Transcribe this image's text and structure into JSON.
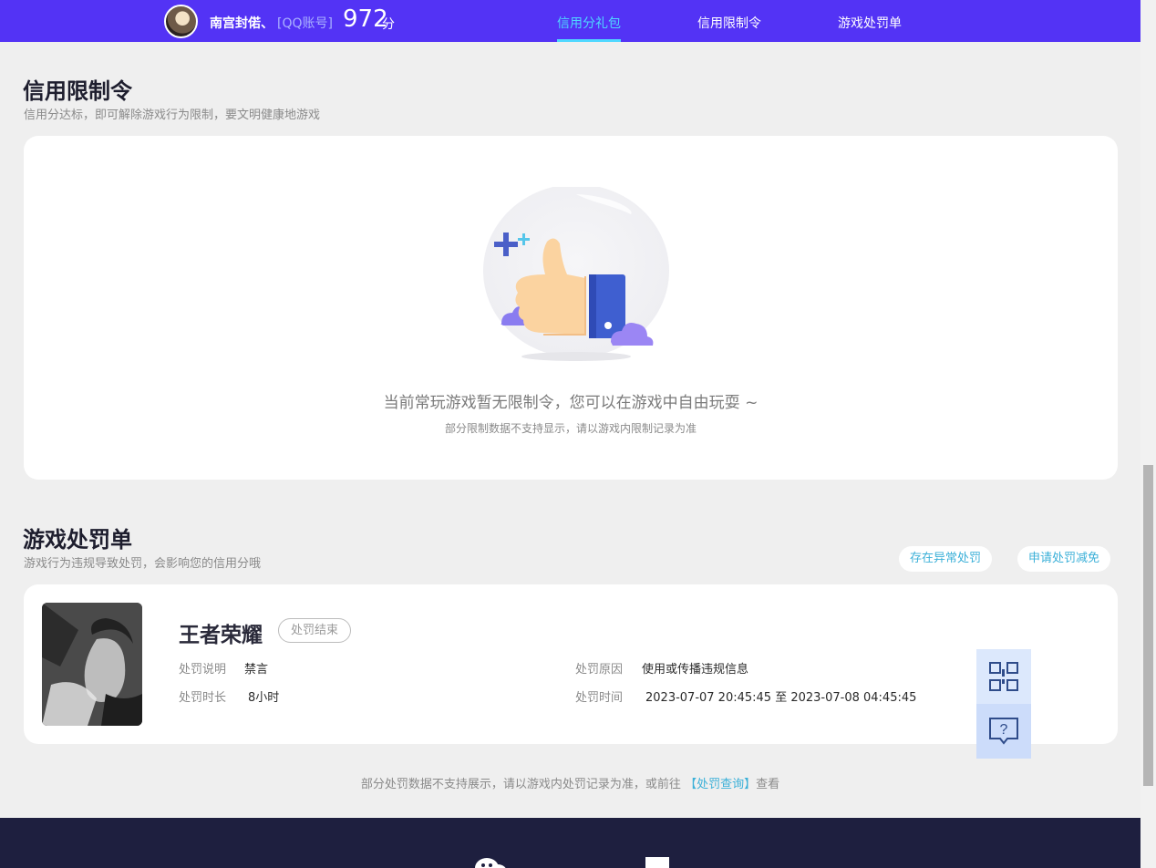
{
  "header": {
    "nickname": "南宫封偌、",
    "account_type": "[QQ账号]",
    "score": "972",
    "score_unit": "分",
    "nav": [
      {
        "label": "信用分礼包",
        "active": true
      },
      {
        "label": "信用限制令",
        "active": false
      },
      {
        "label": "游戏处罚单",
        "active": false
      }
    ],
    "accent_color": "#5333f5",
    "active_color": "#4fd8ff"
  },
  "restriction_section": {
    "title": "信用限制令",
    "subtitle": "信用分达标，即可解除游戏行为限制，要文明健康地游戏",
    "empty_message": "当前常玩游戏暂无限制令，您可以在游戏中自由玩耍 ~",
    "empty_note": "部分限制数据不支持显示，请以游戏内限制记录为准",
    "illustration": "thumbs-up"
  },
  "penalty_section": {
    "title": "游戏处罚单",
    "subtitle": "游戏行为违规导致处罚，会影响您的信用分哦",
    "buttons": {
      "abnormal": "存在异常处罚",
      "appeal": "申请处罚减免"
    },
    "record": {
      "game": "王者荣耀",
      "status": "处罚结束",
      "desc_label": "处罚说明",
      "desc_value": "禁言",
      "duration_label": "处罚时长",
      "duration_value": "8小时",
      "reason_label": "处罚原因",
      "reason_value": "使用或传播违规信息",
      "time_label": "处罚时间",
      "time_value": "2023-07-07 20:45:45 至 2023-07-08 04:45:45"
    },
    "footnote_prefix": "部分处罚数据不支持展示，请以游戏内处罚记录为准，或前往",
    "footnote_link": "【处罚查询】",
    "footnote_suffix": "查看"
  },
  "floating": {
    "qr_icon": "qr-code-icon",
    "help_icon": "help-chat-icon"
  }
}
